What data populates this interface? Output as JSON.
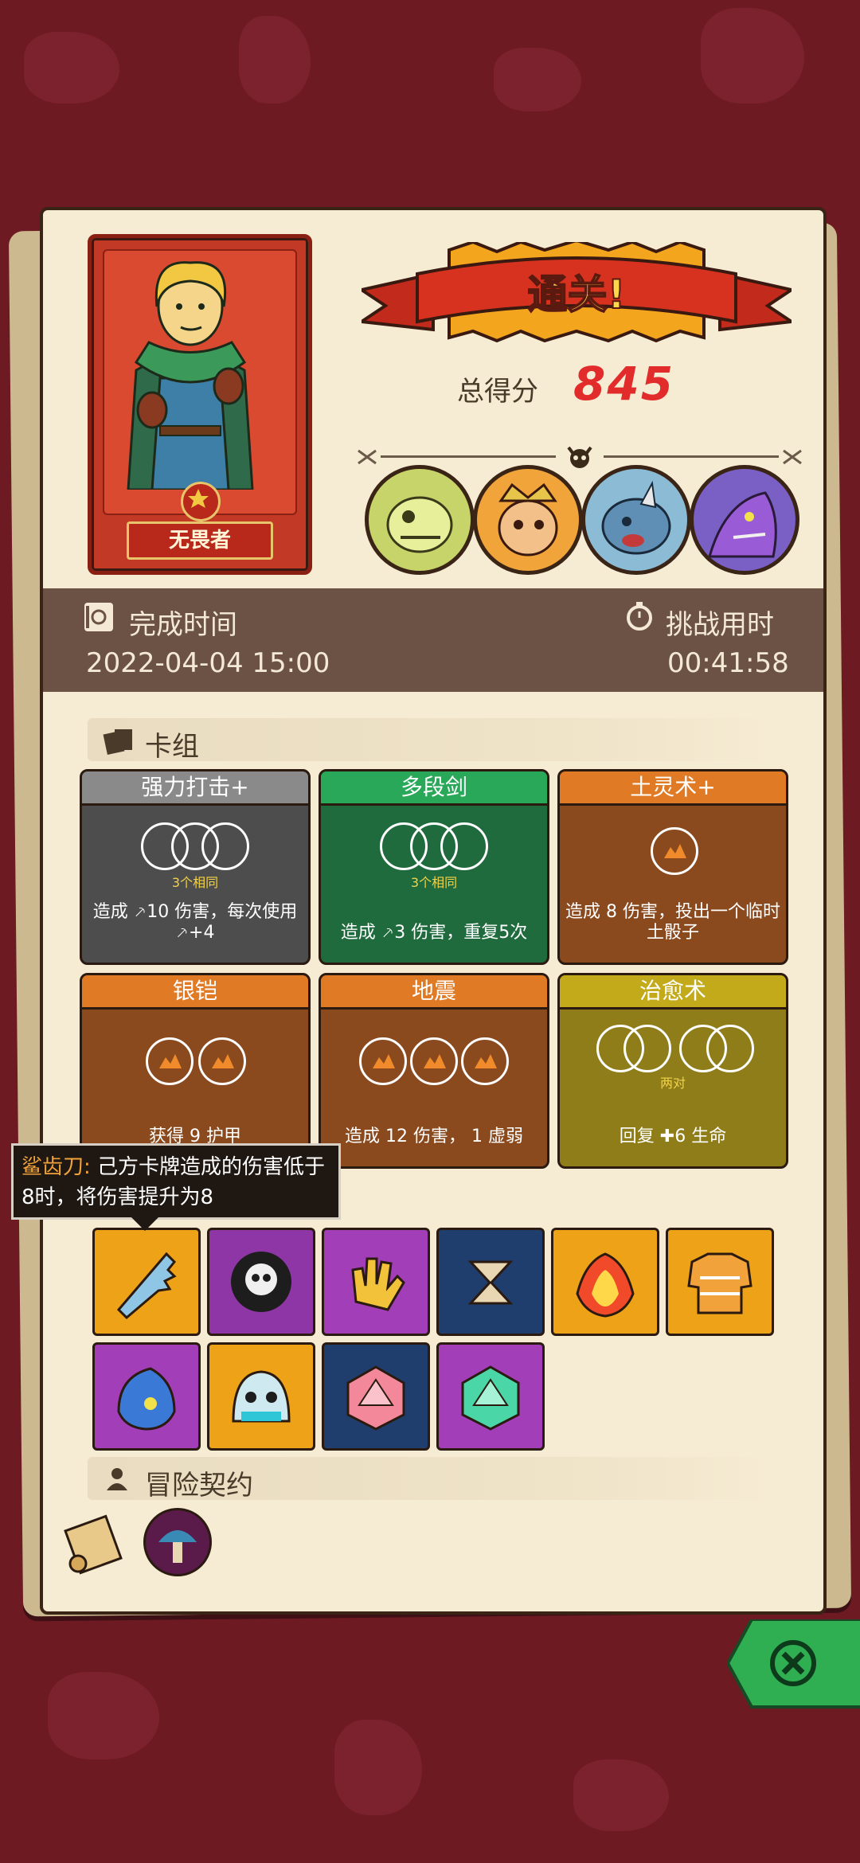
{
  "hero": {
    "name": "无畏者"
  },
  "result": {
    "banner": "通关!",
    "score_label": "总得分",
    "score_value": "845"
  },
  "bosses": [
    "skeleton-lizard-boss-icon",
    "crowned-warlord-boss-icon",
    "blue-rhino-boss-icon",
    "purple-dragon-boss-icon"
  ],
  "completion": {
    "label": "完成时间",
    "value": "2022-04-04 15:00"
  },
  "challenge": {
    "label": "挑战用时",
    "value": "00:41:58"
  },
  "deck": {
    "title": "卡组",
    "cards": [
      {
        "name": "强力打击+",
        "tag": "3个相同",
        "desc": "造成 ⸕10 伤害，每次使用 ⸕+4",
        "color": "#4d4d4d",
        "cap": "#8a8a8a"
      },
      {
        "name": "多段剑",
        "tag": "3个相同",
        "desc": "造成 ⸕3 伤害，重复5次",
        "color": "#1f6b3d",
        "cap": "#2aa85a"
      },
      {
        "name": "土灵术+",
        "tag": "",
        "desc": "造成 8 伤害，投出一个临时土骰子",
        "color": "#8a4a1e",
        "cap": "#e07a25"
      },
      {
        "name": "银铠",
        "tag": "",
        "desc": "获得 9 护甲",
        "color": "#8a4a1e",
        "cap": "#e07a25"
      },
      {
        "name": "地震",
        "tag": "",
        "desc": "造成 12 伤害， 1 虚弱",
        "color": "#8a4a1e",
        "cap": "#e07a25"
      },
      {
        "name": "治愈术",
        "tag": "两对",
        "desc": "回复 ✚6 生命",
        "color": "#8f7d1a",
        "cap": "#c3aa1b"
      }
    ]
  },
  "tooltip": {
    "name": "鲨齿刀:",
    "text": "己方卡牌造成的伤害低于8时，将伤害提升为8"
  },
  "relics": [
    "serrated-blade-icon",
    "skull-burst-icon",
    "golden-glove-icon",
    "hourglass-horn-icon",
    "fire-crystal-icon",
    "knit-sweater-icon",
    "blue-flame-spirit-icon",
    "ghost-slime-icon",
    "pink-dice-icon",
    "green-dice-icon"
  ],
  "contract": {
    "title": "冒险契约",
    "items": [
      "scroll-icon",
      "mushroom-totem-icon"
    ]
  },
  "colors": {
    "background": "#6e1a22",
    "panel": "#f6ecd3",
    "score": "#e22c2c",
    "band": "#6b5244"
  }
}
